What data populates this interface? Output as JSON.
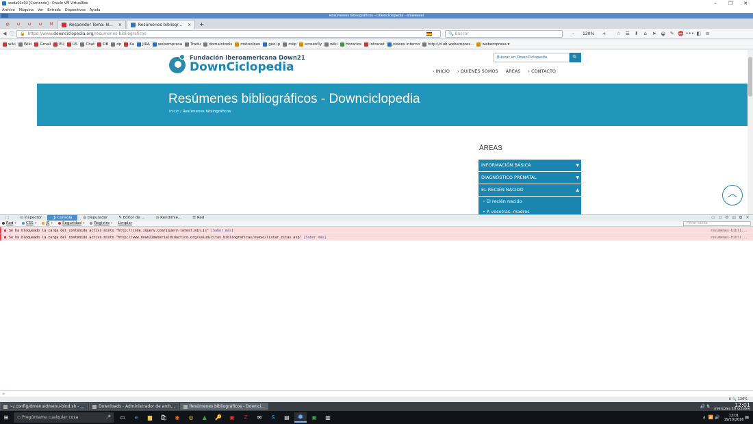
{
  "vbox": {
    "title": "weda01c02 [Corriendo] - Oracle VM VirtualBox",
    "menu": [
      "Archivo",
      "Máquina",
      "Ver",
      "Entrada",
      "Dispositivos",
      "Ayuda"
    ],
    "minimize": "–",
    "restore": "❐",
    "close": "✕"
  },
  "browser": {
    "window_title": "Resúmenes bibliográficos - Downciclopedia - Iceweasel",
    "tabs": [
      {
        "label": "Responder Tema: N...",
        "close": "×"
      },
      {
        "label": "Resúmenes bibliogr...",
        "close": "×"
      }
    ],
    "new_tab": "+",
    "url_prefix": "https://www.",
    "url_domain": "downciclopedia.org",
    "url_path": "/resumenes-bibliograficos",
    "search_placeholder": "Buscar",
    "zoom": "120%",
    "zoom_minus": "–",
    "zoom_plus": "+"
  },
  "bookmarks": [
    "wiki",
    "Wiki",
    "Gmail",
    "EU",
    "US",
    "Chat",
    "DB",
    "dp",
    "Ka",
    "JIRA",
    "webempresa",
    "Tradu",
    "domaintools",
    "mxtoolbox",
    "geo ip",
    "miip",
    "screenfly",
    "wiki",
    "Horarios",
    "intranet",
    "videos interno",
    "http://club.webempres...",
    "webempresa ▾"
  ],
  "site": {
    "logo_line1": "Fundación Iberoamericana Down21",
    "logo_line2": "DownCiclopedia",
    "search_placeholder": "Buscar en DownCiclopedia",
    "search_btn": "🔍",
    "menu": [
      "› INICIO",
      "› QUIÉNES SOMOS",
      "ÁREAS",
      "› CONTACTO"
    ],
    "hero_title": "Resúmenes bibliográficos - Downciclopedia",
    "crumb_home": "Inicio",
    "crumb_sep": " / ",
    "crumb_current": "Resúmenes bibliográficos",
    "areas_title": "ÁREAS",
    "areas": [
      {
        "label": "INFORMACIÓN BÁSICA",
        "arrow": "▼"
      },
      {
        "label": "DIAGNÓSTICO PRENATAL",
        "arrow": "▼"
      },
      {
        "label": "EL RECIÉN NACIDO",
        "arrow": "▲"
      }
    ],
    "subitems": [
      "• El recién nacido",
      "• A vosotras, madres"
    ],
    "back_to_top": "︿"
  },
  "devtools": {
    "tabs": [
      "Inspector",
      "Consola",
      "Depurador",
      "Editor de ...",
      "Rendimie...",
      "Red"
    ],
    "filters": [
      {
        "label": "Red",
        "color": "#4a4a4a"
      },
      {
        "label": "CSS",
        "color": "#4a90d0"
      },
      {
        "label": "JS",
        "color": "#e8a000"
      },
      {
        "label": "Seguridad",
        "color": "#d33"
      },
      {
        "label": "Registro",
        "color": "#888"
      }
    ],
    "clear": "Limpiar",
    "filter_placeholder": "Filtrar salida",
    "messages": [
      {
        "text": "Se ha bloqueado la carga del contenido activo mixto \"http://code.jquery.com/jquery-latest.min.js\"",
        "link": "[Saber más]",
        "source": "resumenes-bibli..."
      },
      {
        "text": "Se ha bloqueado la carga del contenido activo mixto \"http://www.down21materialdidactico.org/salud/citas_bibliograficas/nuevo/listar_citas.asp\"",
        "link": "[Saber más]",
        "source": "resumenes-bibli..."
      }
    ],
    "prompt": "»",
    "status_zoom": "120%"
  },
  "guest_taskbar": {
    "items": [
      "~/.config/dmenu/dmenu-bind.sh - ...",
      "Downloads - Administrador de arch...",
      "Resúmenes bibliográficos - Downci..."
    ],
    "time": "12:01",
    "date": "miércoles 19 octubre"
  },
  "win_taskbar": {
    "search_placeholder": "Pregúntame cualquier cosa",
    "time": "12:01",
    "date": "19/10/2016"
  }
}
